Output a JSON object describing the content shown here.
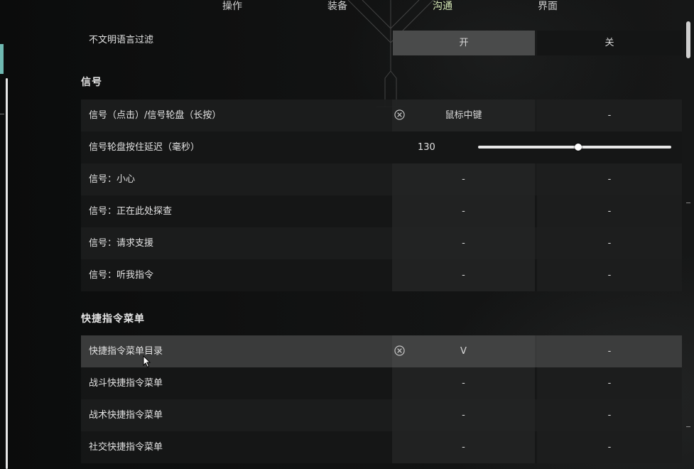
{
  "tabs": [
    {
      "label": "操作",
      "active": false
    },
    {
      "label": "装备",
      "active": false
    },
    {
      "label": "沟通",
      "active": true
    },
    {
      "label": "界面",
      "active": false
    }
  ],
  "profanity_filter": {
    "label": "不文明语言过滤",
    "on_label": "开",
    "off_label": "关",
    "selected": "开"
  },
  "sections": {
    "signal": "信号",
    "quick_menu": "快捷指令菜单"
  },
  "signal_rows": [
    {
      "label": "信号（点击）/信号轮盘（长按）",
      "primary": "鼠标中键",
      "secondary": "-"
    },
    {
      "label": "信号轮盘按住延迟（毫秒）",
      "value": "130",
      "slider_fraction": 0.52
    },
    {
      "label": "信号：小心",
      "primary": "-",
      "secondary": "-"
    },
    {
      "label": "信号：正在此处探查",
      "primary": "-",
      "secondary": "-"
    },
    {
      "label": "信号：请求支援",
      "primary": "-",
      "secondary": "-"
    },
    {
      "label": "信号：听我指令",
      "primary": "-",
      "secondary": "-"
    }
  ],
  "quick_rows": [
    {
      "label": "快捷指令菜单目录",
      "primary": "V",
      "secondary": "-"
    },
    {
      "label": "战斗快捷指令菜单",
      "primary": "-",
      "secondary": "-"
    },
    {
      "label": "战术快捷指令菜单",
      "primary": "-",
      "secondary": "-"
    },
    {
      "label": "社交快捷指令菜单",
      "primary": "-",
      "secondary": "-"
    }
  ],
  "colors": {
    "accent": "#6fb9b2",
    "active_tab": "#d6e8b6",
    "highlight_row": "#3a3b3b"
  },
  "icons": {
    "clear": "circle-x-icon"
  }
}
